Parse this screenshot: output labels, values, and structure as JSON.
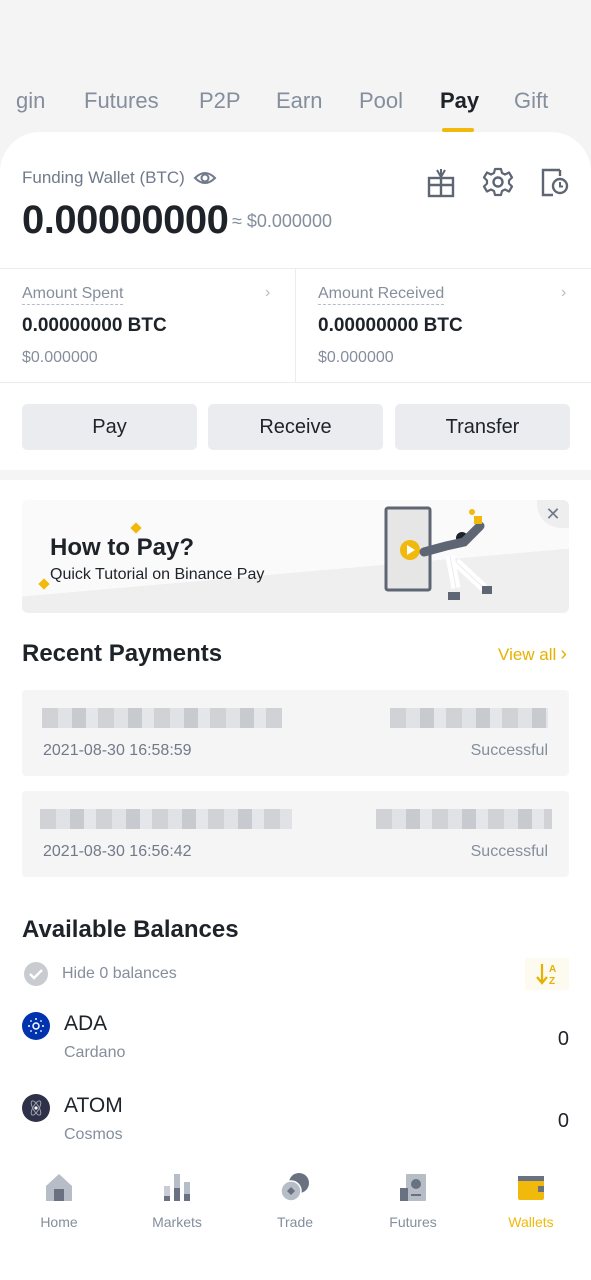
{
  "tabs": [
    {
      "label": "gin",
      "active": false
    },
    {
      "label": "Futures",
      "active": false
    },
    {
      "label": "P2P",
      "active": false
    },
    {
      "label": "Earn",
      "active": false
    },
    {
      "label": "Pool",
      "active": false
    },
    {
      "label": "Pay",
      "active": true
    },
    {
      "label": "Gift",
      "active": false
    }
  ],
  "wallet": {
    "label": "Funding Wallet (BTC)",
    "balance": "0.00000000",
    "approx_usd": "≈ $0.000000",
    "header_icons": [
      "gift-icon",
      "gear-icon",
      "history-icon"
    ]
  },
  "stats": {
    "spent": {
      "label": "Amount Spent",
      "value": "0.00000000 BTC",
      "usd": "$0.000000"
    },
    "received": {
      "label": "Amount Received",
      "value": "0.00000000 BTC",
      "usd": "$0.000000"
    },
    "chevron": "›"
  },
  "actions": {
    "pay": "Pay",
    "receive": "Receive",
    "transfer": "Transfer"
  },
  "banner": {
    "title": "How to Pay?",
    "subtitle": "Quick Tutorial on Binance Pay",
    "close": "✕"
  },
  "recent_payments": {
    "title": "Recent Payments",
    "view_all": "View all",
    "view_all_chevron": "›",
    "items": [
      {
        "date": "2021-08-30 16:58:59",
        "status": "Successful"
      },
      {
        "date": "2021-08-30 16:56:42",
        "status": "Successful"
      }
    ]
  },
  "balances": {
    "title": "Available Balances",
    "hide_zero_label": "Hide 0 balances",
    "sort_icon": "sort-az-icon",
    "coins": [
      {
        "symbol": "ADA",
        "name": "Cardano",
        "amount": "0",
        "color": "#0033ad"
      },
      {
        "symbol": "ATOM",
        "name": "Cosmos",
        "amount": "0",
        "color": "#2e3148"
      }
    ]
  },
  "bottom_nav": [
    {
      "label": "Home",
      "icon": "home-icon",
      "active": false
    },
    {
      "label": "Markets",
      "icon": "markets-icon",
      "active": false
    },
    {
      "label": "Trade",
      "icon": "trade-icon",
      "active": false
    },
    {
      "label": "Futures",
      "icon": "futures-icon",
      "active": false
    },
    {
      "label": "Wallets",
      "icon": "wallet-icon",
      "active": true
    }
  ],
  "colors": {
    "accent": "#f0b90b",
    "text_primary": "#1e2329",
    "text_secondary": "#848e9c"
  }
}
